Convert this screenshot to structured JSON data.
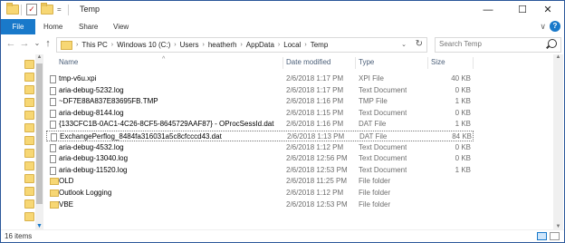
{
  "window": {
    "title": "Temp",
    "qat_dropdown": "=",
    "minimize": "—",
    "maximize": "☐",
    "close": "✕"
  },
  "ribbon": {
    "file_tab": "File",
    "tabs": [
      "Home",
      "Share",
      "View"
    ],
    "expand_glyph": "∨"
  },
  "nav": {
    "back": "←",
    "forward": "→",
    "recent": "⌄",
    "up": "↑"
  },
  "address": {
    "crumbs": [
      "This PC",
      "Windows 10 (C:)",
      "Users",
      "heatherh",
      "AppData",
      "Local",
      "Temp"
    ]
  },
  "search": {
    "placeholder": "Search Temp"
  },
  "columns": {
    "name": "Name",
    "date": "Date modified",
    "type": "Type",
    "size": "Size"
  },
  "files": [
    {
      "name": "tmp-v6u.xpi",
      "date": "2/6/2018 1:17 PM",
      "type": "XPI File",
      "size": "40 KB",
      "icon": "file-icon"
    },
    {
      "name": "aria-debug-5232.log",
      "date": "2/6/2018 1:17 PM",
      "type": "Text Document",
      "size": "0 KB",
      "icon": "file-icon"
    },
    {
      "name": "~DF7E88A837E83695FB.TMP",
      "date": "2/6/2018 1:16 PM",
      "type": "TMP File",
      "size": "1 KB",
      "icon": "file-icon"
    },
    {
      "name": "aria-debug-8144.log",
      "date": "2/6/2018 1:15 PM",
      "type": "Text Document",
      "size": "0 KB",
      "icon": "file-icon"
    },
    {
      "name": "{133CFC1B-0AC1-4C26-8CF5-8645729AAF87} - OProcSessId.dat",
      "date": "2/6/2018 1:16 PM",
      "type": "DAT File",
      "size": "1 KB",
      "icon": "file-icon"
    },
    {
      "name": "ExchangePerflog_8484fa316031a5c8cfcccd43.dat",
      "date": "2/6/2018 1:13 PM",
      "type": "DAT File",
      "size": "84 KB",
      "icon": "file-icon"
    },
    {
      "name": "aria-debug-4532.log",
      "date": "2/6/2018 1:12 PM",
      "type": "Text Document",
      "size": "0 KB",
      "icon": "file-icon"
    },
    {
      "name": "aria-debug-13040.log",
      "date": "2/6/2018 12:56 PM",
      "type": "Text Document",
      "size": "0 KB",
      "icon": "file-icon"
    },
    {
      "name": "aria-debug-11520.log",
      "date": "2/6/2018 12:53 PM",
      "type": "Text Document",
      "size": "1 KB",
      "icon": "file-icon"
    },
    {
      "name": "OLD",
      "date": "2/6/2018 11:25 PM",
      "type": "File folder",
      "size": "",
      "icon": "folder-icon"
    },
    {
      "name": "Outlook Logging",
      "date": "2/6/2018 1:12 PM",
      "type": "File folder",
      "size": "",
      "icon": "folder-icon"
    },
    {
      "name": "VBE",
      "date": "2/6/2018 12:53 PM",
      "type": "File folder",
      "size": "",
      "icon": "folder-icon"
    }
  ],
  "status": {
    "item_count": "16 items"
  }
}
